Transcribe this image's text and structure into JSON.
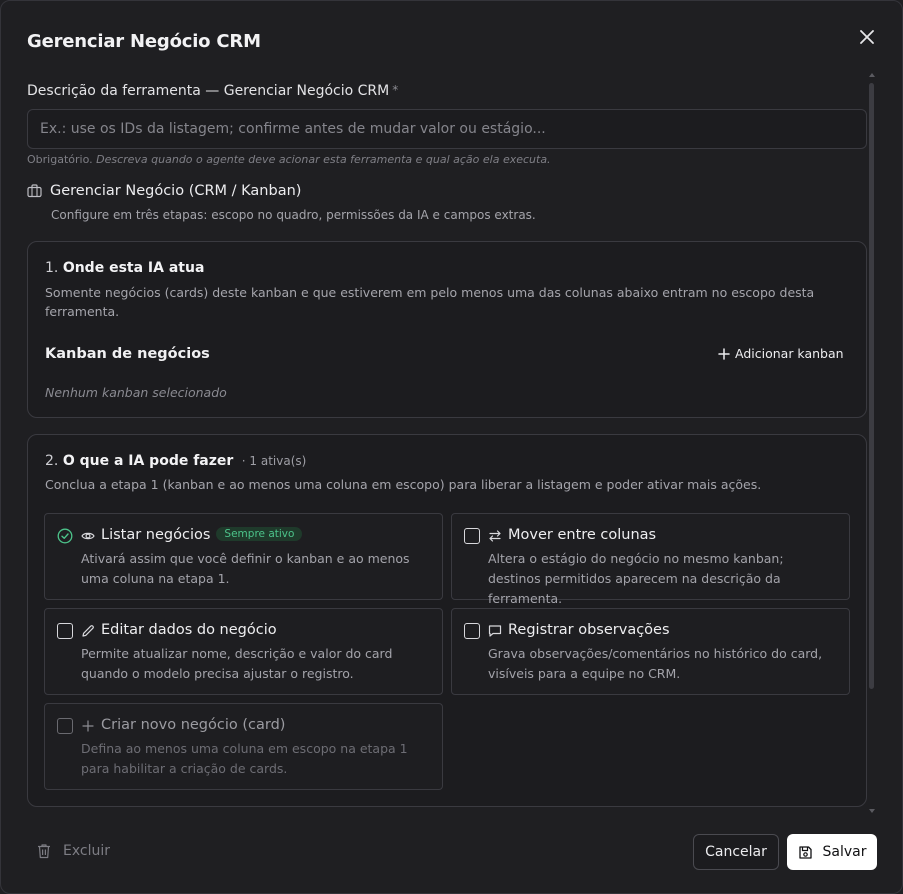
{
  "dialog": {
    "title": "Gerenciar Negócio CRM"
  },
  "description_field": {
    "label": "Descrição da ferramenta — Gerenciar Negócio CRM",
    "required_mark": "*",
    "placeholder": "Ex.: use os IDs da listagem; confirme antes de mudar valor ou estágio...",
    "value": "",
    "hint_prefix": "Obrigatório.",
    "hint_text": "Descreva quando o agente deve acionar esta ferramenta e qual ação ela executa."
  },
  "section": {
    "title": "Gerenciar Negócio (CRM / Kanban)",
    "subtitle": "Configure em três etapas: escopo no quadro, permissões da IA e campos extras."
  },
  "step1": {
    "number": "1.",
    "title": "Onde esta IA atua",
    "description": "Somente negócios (cards) deste kanban e que estiverem em pelo menos uma das colunas abaixo entram no escopo desta ferramenta.",
    "kanban_title": "Kanban de negócios",
    "add_kanban_label": "Adicionar kanban",
    "empty_text": "Nenhum kanban selecionado"
  },
  "step2": {
    "number": "2.",
    "title": "O que a IA pode fazer",
    "count": "· 1 ativa(s)",
    "description": "Conclua a etapa 1 (kanban e ao menos uma coluna em escopo) para liberar a listagem e poder ativar mais ações.",
    "options": [
      {
        "title": "Listar negócios",
        "badge": "Sempre ativo",
        "description": "Ativará assim que você definir o kanban e ao menos uma coluna na etapa 1.",
        "icon": "eye-icon",
        "checked": true
      },
      {
        "title": "Mover entre colunas",
        "description": "Altera o estágio do negócio no mesmo kanban; destinos permitidos aparecem na descrição da ferramenta.",
        "icon": "arrows-swap-icon",
        "checked": false
      },
      {
        "title": "Editar dados do negócio",
        "description": "Permite atualizar nome, descrição e valor do card quando o modelo precisa ajustar o registro.",
        "icon": "pencil-icon",
        "checked": false
      },
      {
        "title": "Registrar observações",
        "description": "Grava observações/comentários no histórico do card, visíveis para a equipe no CRM.",
        "icon": "comment-icon",
        "checked": false
      },
      {
        "title": "Criar novo negócio (card)",
        "description": "Defina ao menos uma coluna em escopo na etapa 1 para habilitar a criação de cards.",
        "icon": "plus-icon",
        "checked": false,
        "disabled": true
      }
    ]
  },
  "footer": {
    "delete_label": "Excluir",
    "cancel_label": "Cancelar",
    "save_label": "Salvar"
  },
  "colors": {
    "background": "#1f1f22",
    "border": "#3a3a40",
    "accent_green": "#4cc38a",
    "primary_button": "#ffffff"
  }
}
